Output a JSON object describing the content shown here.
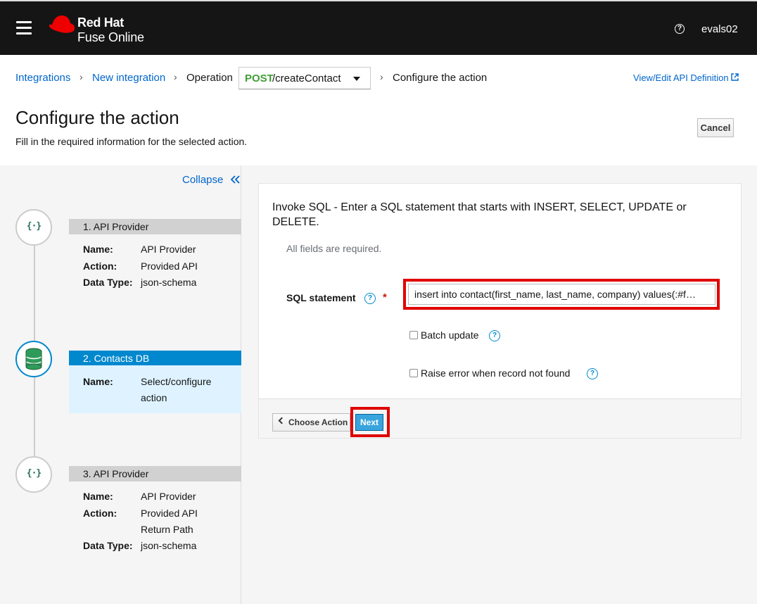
{
  "masthead": {
    "brand_line1": "Red Hat",
    "brand_line2": "Fuse Online",
    "help_icon": "question-circle-icon",
    "username": "evals02"
  },
  "breadcrumb": {
    "items": [
      "Integrations",
      "New integration",
      "Operation"
    ],
    "operation_method": "POST",
    "operation_path": "/createContact",
    "current": "Configure the action",
    "api_definition_link": "View/Edit API Definition"
  },
  "page": {
    "title": "Configure the action",
    "description": "Fill in the required information for the selected action.",
    "cancel_label": "Cancel"
  },
  "sidebar": {
    "collapse_label": "Collapse",
    "steps": [
      {
        "header": "1. API Provider",
        "icon": "api-icon",
        "glyph": "{·}",
        "fields": [
          {
            "key": "Name:",
            "value": "API Provider"
          },
          {
            "key": "Action:",
            "value": "Provided API"
          },
          {
            "key": "Data Type:",
            "value": "json-schema"
          }
        ]
      },
      {
        "header": "2. Contacts DB",
        "icon": "database-icon",
        "active": true,
        "fields": [
          {
            "key": "Name:",
            "value": "Select/configure",
            "value2": "action"
          }
        ]
      },
      {
        "header": "3. API Provider",
        "icon": "api-icon",
        "glyph": "{·}",
        "fields": [
          {
            "key": "Name:",
            "value": "API Provider"
          },
          {
            "key": "Action:",
            "value": "Provided API",
            "value2": "Return Path"
          },
          {
            "key": "Data Type:",
            "value": "json-schema"
          }
        ]
      }
    ]
  },
  "form": {
    "title": "Invoke SQL - Enter a SQL statement that starts with INSERT, SELECT, UPDATE or DELETE.",
    "subtitle": "All fields are required.",
    "sql_label": "SQL statement",
    "required_marker": "*",
    "sql_value": "insert into contact(first_name, last_name, company) values(:#f…",
    "batch_update_label": "Batch update",
    "raise_error_label": "Raise error when record not found",
    "help_glyph": "?"
  },
  "footer": {
    "choose_action_label": "Choose Action",
    "next_label": "Next"
  },
  "colors": {
    "masthead_bg": "#151515",
    "link": "#0066cc",
    "active_step": "#0088ce",
    "active_step_body": "#def3ff",
    "method_post": "#3f9c35",
    "primary_button": "#39a5dc",
    "highlight": "#e00000",
    "brand_red": "#ee0000"
  }
}
